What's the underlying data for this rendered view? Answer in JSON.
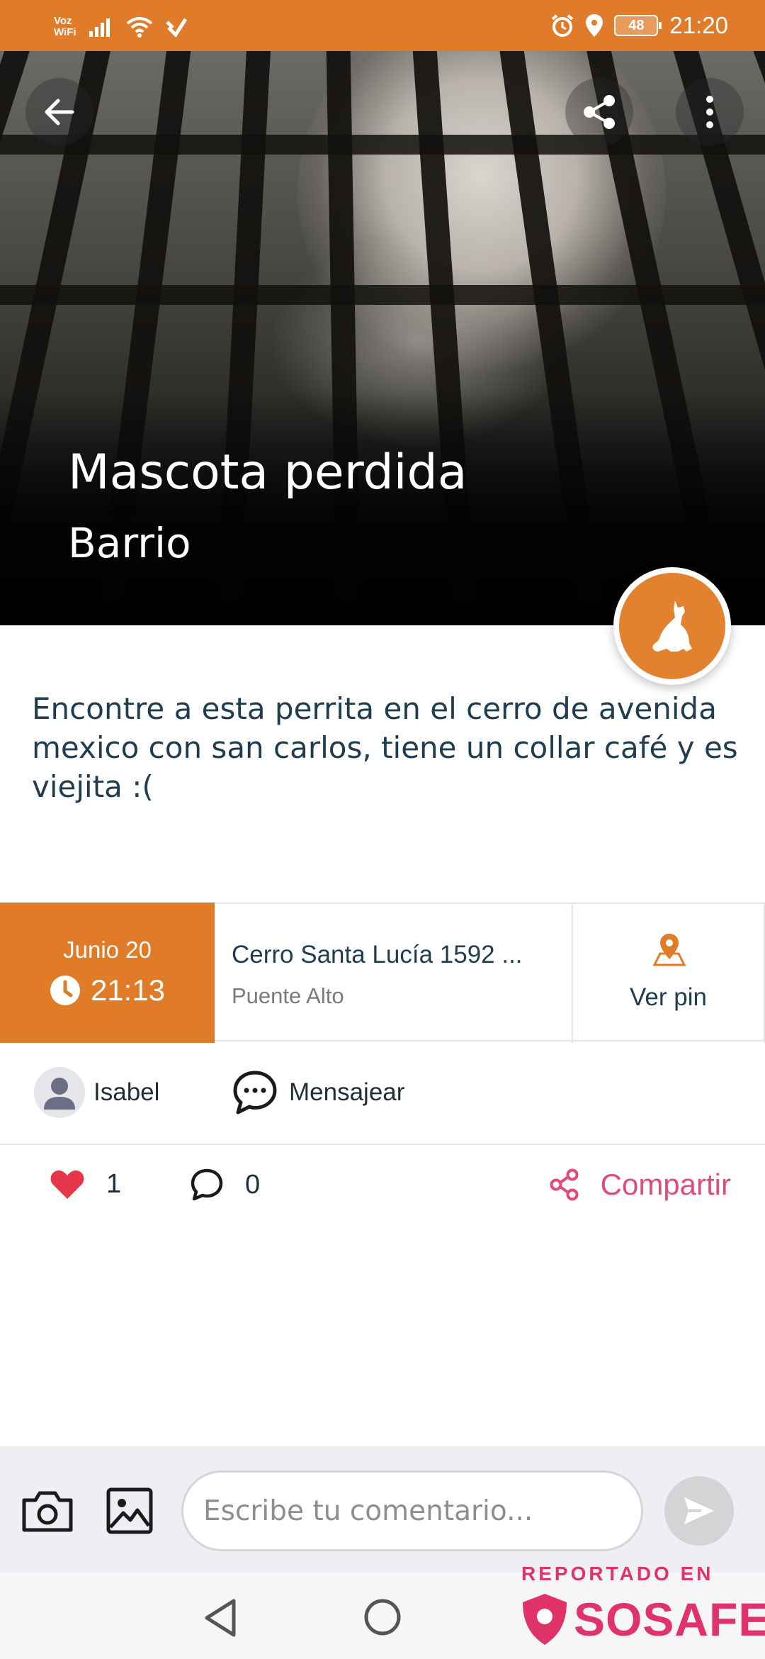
{
  "status_bar": {
    "network_label": "Voz\nWiFi",
    "battery": "48",
    "time": "21:20"
  },
  "post": {
    "title": "Mascota perdida",
    "subtitle": "Barrio",
    "description": "Encontre a esta perrita en el cerro de avenida mexico con san carlos, tiene un collar café y es viejita :(",
    "accent_color": "#df7b29"
  },
  "info": {
    "date": "Junio 20",
    "time": "21:13",
    "address": "Cerro Santa Lucía  1592 ...",
    "commune": "Puente Alto",
    "pin_label": "Ver pin"
  },
  "user": {
    "name": "Isabel",
    "message_label": "Mensajear"
  },
  "actions": {
    "likes": "1",
    "comments": "0",
    "share_label": "Compartir"
  },
  "comment_bar": {
    "placeholder": "Escribe tu comentario..."
  },
  "watermark": {
    "top": "REPORTADO EN",
    "brand": "SOSAFE"
  },
  "icons": [
    "back-arrow-icon",
    "share-icon",
    "more-vert-icon",
    "dog-icon",
    "clock-icon",
    "map-pin-icon",
    "person-icon",
    "chat-bubble-icon",
    "heart-icon",
    "comment-icon",
    "camera-icon",
    "image-icon",
    "send-icon",
    "nav-back-icon",
    "nav-home-icon"
  ]
}
